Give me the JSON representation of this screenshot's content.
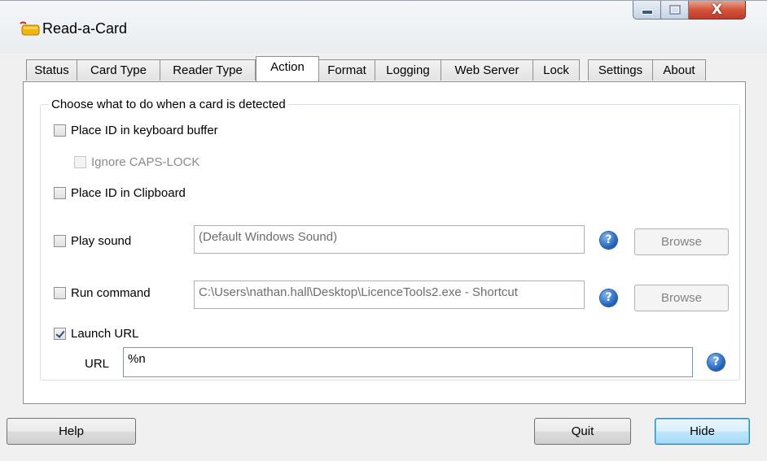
{
  "window": {
    "title": "Read-a-Card",
    "close_glyph": "X",
    "icons": {
      "app": "card-reader-icon",
      "minimize": "minimize-icon",
      "maximize": "maximize-icon",
      "close": "close-icon"
    }
  },
  "tabs": [
    {
      "label": "Status"
    },
    {
      "label": "Card Type"
    },
    {
      "label": "Reader Type"
    },
    {
      "label": "Action",
      "active": true
    },
    {
      "label": "Format"
    },
    {
      "label": "Logging"
    },
    {
      "label": "Web Server"
    },
    {
      "label": "Lock"
    },
    {
      "label": "Settings"
    },
    {
      "label": "About"
    }
  ],
  "action": {
    "group_title": "Choose what to do when a card is detected",
    "keyboard_buffer": {
      "label": "Place ID in keyboard buffer",
      "checked": false
    },
    "ignore_caps_lock": {
      "label": "Ignore CAPS-LOCK",
      "checked": false,
      "enabled": false
    },
    "clipboard": {
      "label": "Place ID in Clipboard",
      "checked": false
    },
    "play_sound": {
      "label": "Play sound",
      "checked": false,
      "value": "(Default Windows Sound)",
      "browse_label": "Browse"
    },
    "run_command": {
      "label": "Run command",
      "checked": false,
      "value": "C:\\Users\\nathan.hall\\Desktop\\LicenceTools2.exe - Shortcut",
      "browse_label": "Browse"
    },
    "launch_url": {
      "label": "Launch URL",
      "checked": true,
      "url_label": "URL",
      "url_value": "%n"
    },
    "help_glyph": "?"
  },
  "footer": {
    "help_label": "Help",
    "quit_label": "Quit",
    "hide_label": "Hide"
  },
  "colors": {
    "close_button": "#c0392b",
    "help_icon": "#1c5fb8",
    "default_button_border": "#3c7fb1"
  }
}
